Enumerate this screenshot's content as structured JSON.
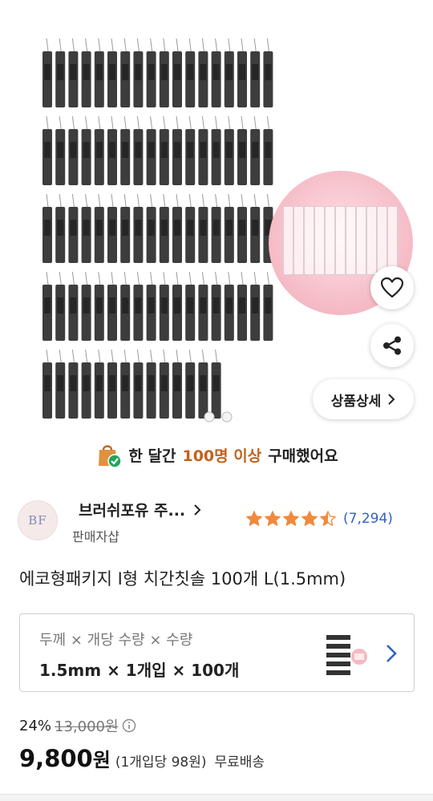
{
  "banner": {
    "prefix": "한 달간",
    "highlight": "100명 이상",
    "suffix": "구매했어요"
  },
  "hero": {
    "detail_label": "상품상세"
  },
  "seller": {
    "logo_text": "BF",
    "name": "브러쉬포유 주...",
    "type": "판매자샵"
  },
  "rating": {
    "stars": 4.5,
    "count": "(7,294)"
  },
  "product": {
    "title": "에코형패키지 I형 치간칫솔 100개 L(1.5mm)"
  },
  "option": {
    "label": "두께 × 개당 수량 × 수량",
    "value": "1.5mm × 1개입 × 100개"
  },
  "price": {
    "discount": "24%",
    "original": "13,000원",
    "final_number": "9,800",
    "final_unit": "원",
    "per_unit": "(1개입당 98원)",
    "shipping": "무료배송"
  },
  "colors": {
    "accent": "#c4621d",
    "star": "#f08a3c",
    "link": "#3560c6"
  }
}
